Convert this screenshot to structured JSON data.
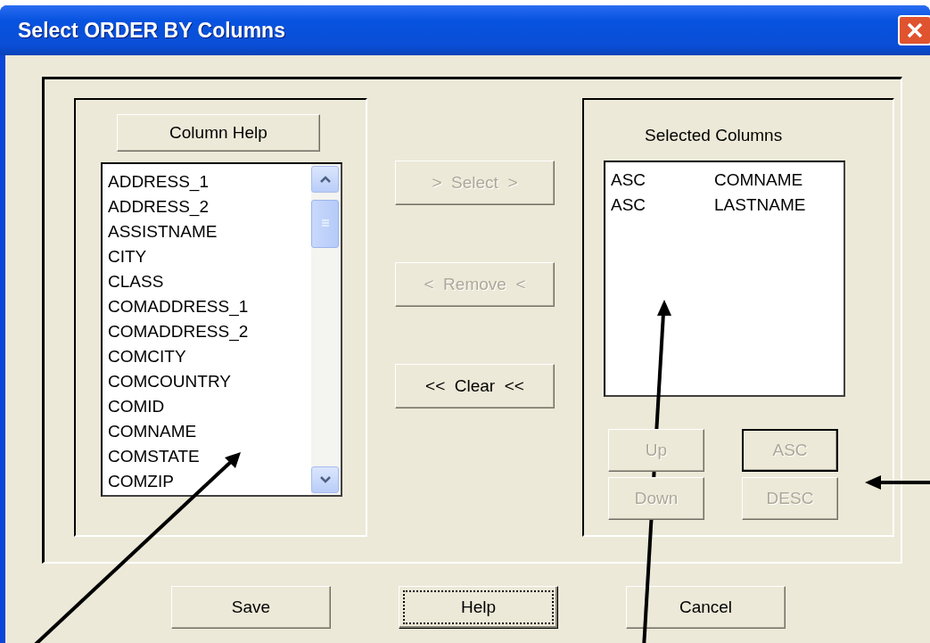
{
  "window": {
    "title": "Select ORDER BY Columns"
  },
  "column_help_button": {
    "label": "Column Help"
  },
  "available_columns": {
    "items": [
      {
        "label": "ADDRESS_1",
        "selected": false
      },
      {
        "label": "ADDRESS_2",
        "selected": false
      },
      {
        "label": "ASSISTNAME",
        "selected": false
      },
      {
        "label": "CITY",
        "selected": false
      },
      {
        "label": "CLASS",
        "selected": false
      },
      {
        "label": "COMADDRESS_1",
        "selected": false
      },
      {
        "label": "COMADDRESS_2",
        "selected": false
      },
      {
        "label": "COMCITY",
        "selected": false
      },
      {
        "label": "COMCOUNTRY",
        "selected": false
      },
      {
        "label": "COMID",
        "selected": false
      },
      {
        "label": "COMNAME",
        "selected": false
      },
      {
        "label": "COMSTATE",
        "selected": false
      },
      {
        "label": "COMZIP",
        "selected": false
      }
    ]
  },
  "transfer_buttons": [
    {
      "label": ">  Select  >",
      "disabled": true
    },
    {
      "label": "<  Remove  <",
      "disabled": true
    },
    {
      "label": "<<  Clear  <<",
      "disabled": false
    }
  ],
  "selected_columns": {
    "title": "Selected Columns",
    "rows": [
      {
        "order": "ASC",
        "column": "COMNAME",
        "selected": false
      },
      {
        "order": "ASC",
        "column": "LASTNAME",
        "selected": false
      }
    ]
  },
  "order_buttons": [
    {
      "label": "Up",
      "disabled": true,
      "default": false
    },
    {
      "label": "ASC",
      "disabled": true,
      "default": true
    },
    {
      "label": "Down",
      "disabled": true,
      "default": false
    },
    {
      "label": "DESC",
      "disabled": true,
      "default": false
    }
  ],
  "dialog_buttons": [
    {
      "label": "Save",
      "focused": false
    },
    {
      "label": "Help",
      "focused": true
    },
    {
      "label": "Cancel",
      "focused": false
    }
  ]
}
